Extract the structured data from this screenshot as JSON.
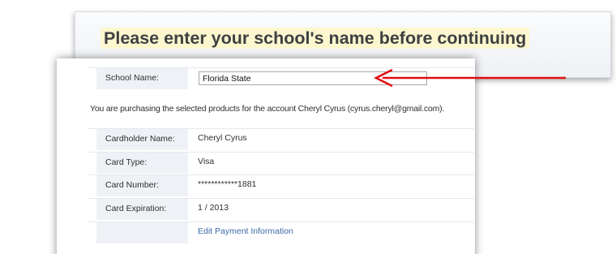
{
  "banner": {
    "title": "Please enter your school's name before continuing"
  },
  "school": {
    "label": "School Name:",
    "value": "Florida State"
  },
  "purchase_note": "You are purchasing the selected products for the account Cheryl Cyrus (cyrus.cheryl@gmail.com).",
  "payment": {
    "rows": [
      {
        "label": "Cardholder Name:",
        "value": "Cheryl Cyrus"
      },
      {
        "label": "Card Type:",
        "value": "Visa"
      },
      {
        "label": "Card Number:",
        "value": "************1881"
      },
      {
        "label": "Card Expiration:",
        "value": "1 / 2013"
      }
    ],
    "edit_link": "Edit Payment Information"
  },
  "colors": {
    "highlight": "#fdf7cf",
    "label_bg": "#eef1f5",
    "link": "#3b6aa8",
    "arrow": "#e01010"
  }
}
